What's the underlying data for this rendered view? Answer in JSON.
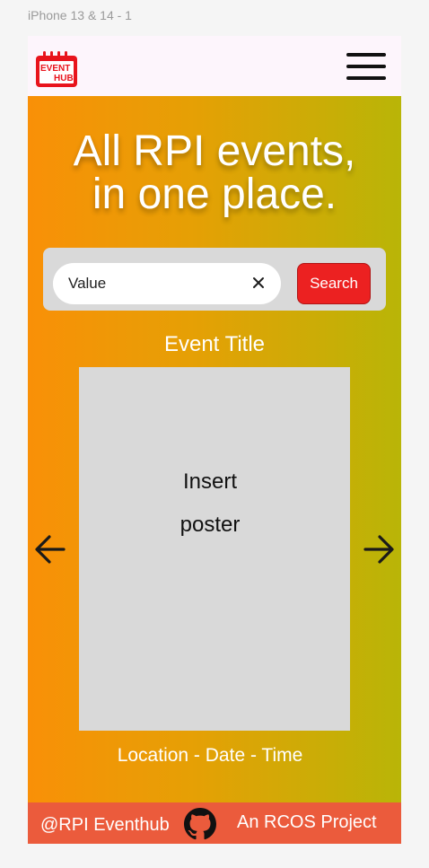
{
  "frame": {
    "label": "iPhone 13 & 14 - 1"
  },
  "header": {
    "logo_line1": "EVENT",
    "logo_line2": "HUB",
    "logo_icon": "calendar-logo-icon",
    "menu_icon": "hamburger-menu-icon"
  },
  "hero": {
    "headline_line1": "All RPI events,",
    "headline_line2": "in one place."
  },
  "search": {
    "value": "Value",
    "clear_icon": "close-icon",
    "button_label": "Search"
  },
  "event": {
    "title": "Event Title",
    "poster_line1": "Insert",
    "poster_line2": "poster",
    "meta": "Location - Date - Time",
    "prev_icon": "arrow-left-icon",
    "next_icon": "arrow-right-icon"
  },
  "footer": {
    "left_text": "@RPI Eventhub",
    "right_text": "An RCOS Project",
    "github_icon": "github-icon"
  },
  "colors": {
    "header_bg": "#fdf5fc",
    "gradient_start": "#f99007",
    "gradient_end": "#b9b507",
    "search_button": "#ec2121",
    "footer_bg": "#eb5b3c",
    "poster_bg": "#d9d9d9"
  }
}
